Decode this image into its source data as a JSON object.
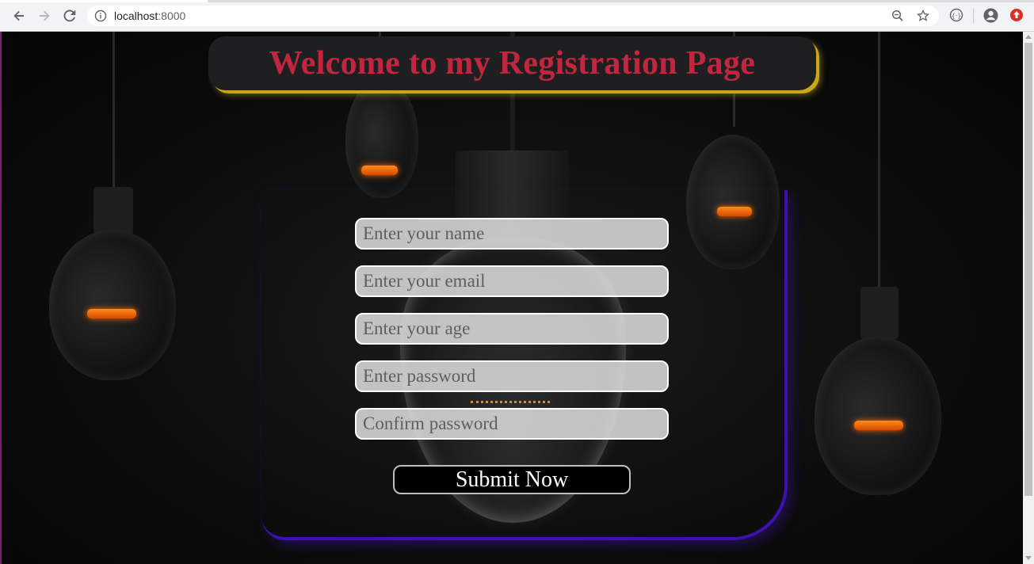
{
  "browser": {
    "url_host": "localhost",
    "url_port": ":8000",
    "icons": [
      "back-icon",
      "forward-icon",
      "reload-icon",
      "info-icon",
      "zoom-icon",
      "star-icon",
      "extension-icon",
      "profile-icon",
      "update-icon"
    ]
  },
  "header": {
    "title": "Welcome to my Registration Page"
  },
  "form": {
    "name_placeholder": "Enter your name",
    "email_placeholder": "Enter your email",
    "age_placeholder": "Enter your age",
    "password_placeholder": "Enter password",
    "confirm_placeholder": "Confirm password",
    "submit_label": "Submit Now"
  },
  "colors": {
    "title": "#c2263f",
    "header_shadow": "#c9a716",
    "frame_border": "#3d10b0",
    "filament": "#ff7a0a"
  }
}
